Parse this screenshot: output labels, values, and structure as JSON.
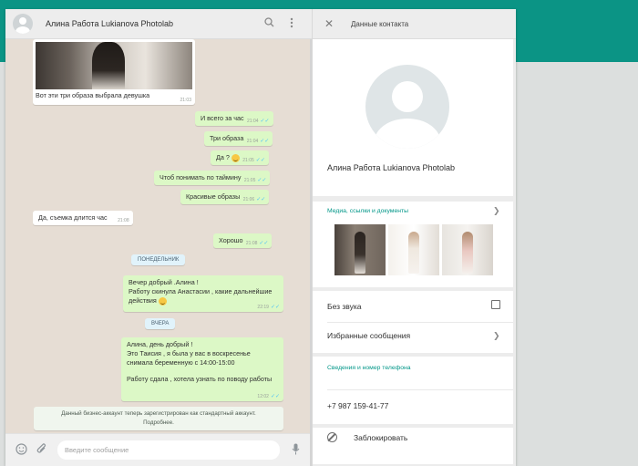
{
  "chat": {
    "title": "Алина Работа Lukianova Photolab",
    "photo_caption": "Вот эти три образа выбрала девушка",
    "photo_time": "21:03",
    "messages": [
      {
        "text": "И всего за час",
        "time": "21:04"
      },
      {
        "text": "Три образа",
        "time": "21:04"
      },
      {
        "text": "Да ?",
        "time": "21:05"
      },
      {
        "text": "Чтоб понимать по таймину",
        "time": "21:05"
      },
      {
        "text": "Красивые образы",
        "time": "21:06"
      },
      {
        "text": "Да, съемка длится час",
        "time": "21:08"
      },
      {
        "text": "Хорошо",
        "time": "21:08"
      }
    ],
    "day_monday": "ПОНЕДЕЛЬНИК",
    "msg_monday": {
      "line1": "Вечер добрый .Алина !",
      "line2": "Работу скинула Анастасии , какие дальнейшие",
      "line3": "действия",
      "time": "22:19"
    },
    "day_yesterday": "ВЧЕРА",
    "msg_yesterday": {
      "line1": "Алина,  день добрый !",
      "line2": "Это Таисия , я была у вас в воскресенье",
      "line3": "снимала беременную с 14:00-15:00",
      "line4": "Работу сдала , хотела узнать по поводу работы",
      "time": "12:02"
    },
    "system_line1": "Данный бизнес-аккаунт теперь зарегистрирован как стандартный аккаунт.",
    "system_line2": "Подробнее.",
    "composer_placeholder": "Введите сообщение"
  },
  "panel": {
    "title": "Данные контакта",
    "contact_name": "Алина Работа Lukianova Photolab",
    "media_label": "Медиа, ссылки и документы",
    "mute_label": "Без звука",
    "starred_label": "Избранные сообщения",
    "info_label": "Сведения и номер телефона",
    "phone": "+7 987 159-41-77",
    "block_label": "Заблокировать"
  },
  "icons": {
    "search": "search-icon",
    "menu": "menu-icon",
    "emoji": "emoji-icon",
    "attach": "attach-icon",
    "mic": "mic-icon",
    "close": "close-icon",
    "chevron": "chevron-right-icon",
    "block": "block-icon"
  },
  "colors": {
    "accent": "#009688",
    "header_band": "#0b9485",
    "outgoing_bubble": "#dcf8c6",
    "chat_bg": "#e6ddd4"
  }
}
